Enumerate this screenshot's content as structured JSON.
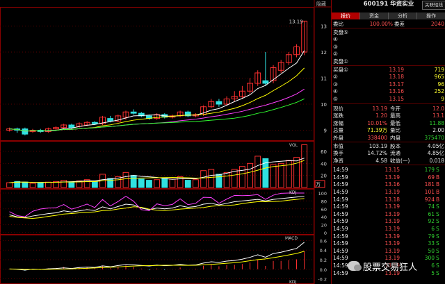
{
  "stock": {
    "code": "600191",
    "name": "华资实业",
    "hint_btn": "关联短线"
  },
  "top_button": "隐藏",
  "tabs": [
    "报价",
    "资金",
    "分析",
    "操作"
  ],
  "weibi": {
    "label": "委比",
    "pct": "100.00%",
    "label2": "委差",
    "value": "2040"
  },
  "sell_rows": [
    {
      "label": "卖盘⑤",
      "price": "",
      "vol": ""
    },
    {
      "label": "④",
      "price": "",
      "vol": ""
    },
    {
      "label": "③",
      "price": "",
      "vol": ""
    },
    {
      "label": "②",
      "price": "",
      "vol": ""
    },
    {
      "label": "卖盘①",
      "price": "",
      "vol": ""
    }
  ],
  "buy_rows": [
    {
      "label": "买盘①",
      "price": "13.19",
      "vol": "719"
    },
    {
      "label": "②",
      "price": "13.18",
      "vol": "965"
    },
    {
      "label": "③",
      "price": "13.17",
      "vol": "96"
    },
    {
      "label": "④",
      "price": "13.16",
      "vol": "252"
    },
    {
      "label": "⑤",
      "price": "13.15",
      "vol": "9"
    }
  ],
  "stats": [
    {
      "l1": "现价",
      "v1": "13.19",
      "l2": "今开",
      "v2": "12.0"
    },
    {
      "l1": "涨跌",
      "v1": "1.20",
      "l2": "最高",
      "v2": "13.1"
    },
    {
      "l1": "涨幅",
      "v1": "10.01%",
      "l2": "最低",
      "v2": "11.88"
    },
    {
      "l1": "总量",
      "v1": "71.39万",
      "l2": "量比",
      "v2": "2.00"
    },
    {
      "l1": "外盘",
      "v1": "338400",
      "l2": "内盘",
      "v2": "375470"
    }
  ],
  "stats2": [
    {
      "l1": "市值",
      "v1": "103.19",
      "l2": "股本",
      "v2": "4.05亿"
    },
    {
      "l1": "换手",
      "v1": "14.72%",
      "l2": "流通",
      "v2": "4.85亿"
    },
    {
      "l1": "净资",
      "v1": "4.58",
      "l2": "收益(一)",
      "v2": "0.018"
    }
  ],
  "ticks": [
    {
      "time": "14:59",
      "price": "13.15",
      "vol": "179",
      "bs": "S"
    },
    {
      "time": "14:59",
      "price": "13.19",
      "vol": "69",
      "bs": "B"
    },
    {
      "time": "14:59",
      "price": "13.16",
      "vol": "181",
      "bs": "B"
    },
    {
      "time": "14:59",
      "price": "13.19",
      "vol": "101",
      "bs": "B"
    },
    {
      "time": "14:59",
      "price": "13.18",
      "vol": "924",
      "bs": "B"
    },
    {
      "time": "14:59",
      "price": "13.19",
      "vol": "74",
      "bs": "S"
    },
    {
      "time": "14:59",
      "price": "13.19",
      "vol": "61",
      "bs": "S"
    },
    {
      "time": "14:59",
      "price": "13.19",
      "vol": "92",
      "bs": "S"
    },
    {
      "time": "14:59",
      "price": "13.19",
      "vol": "6",
      "bs": "S"
    },
    {
      "time": "14:59",
      "price": "13.19",
      "vol": "79",
      "bs": "S"
    },
    {
      "time": "14:59",
      "price": "13.19",
      "vol": "33",
      "bs": "S"
    },
    {
      "time": "14:59",
      "price": "13.19",
      "vol": "50",
      "bs": "S"
    },
    {
      "time": "14:59",
      "price": "13.19",
      "vol": "300",
      "bs": "S"
    },
    {
      "time": "14:59",
      "price": "13.19",
      "vol": "6",
      "bs": "S"
    },
    {
      "time": "14:59",
      "price": "13.19",
      "vol": "5",
      "bs": "S"
    }
  ],
  "chart": {
    "price_label": "13.19",
    "price_axis": [
      "13",
      "12",
      "11",
      "10",
      "9"
    ],
    "vol_label": "VOL",
    "vol_axis": [
      "60",
      "40",
      "20"
    ],
    "vol_unit": "万",
    "kdj_label": "KDJ",
    "kdj_axis": [
      "100",
      "80",
      "60",
      "40",
      "20",
      "0"
    ],
    "macd_label": "MACD",
    "macd_axis": [
      "0.6",
      "0.4",
      "0.2",
      "0.0",
      "-0.2"
    ],
    "bottom_label": "KDJ"
  },
  "watermark": "股票交易狂人",
  "colors": {
    "up": "#ff3030",
    "down": "#30e0e0",
    "ma5": "#ffffff",
    "ma10": "#ffff00",
    "ma20": "#ff40ff",
    "ma30": "#30ff30",
    "grid": "#8a0000"
  }
}
